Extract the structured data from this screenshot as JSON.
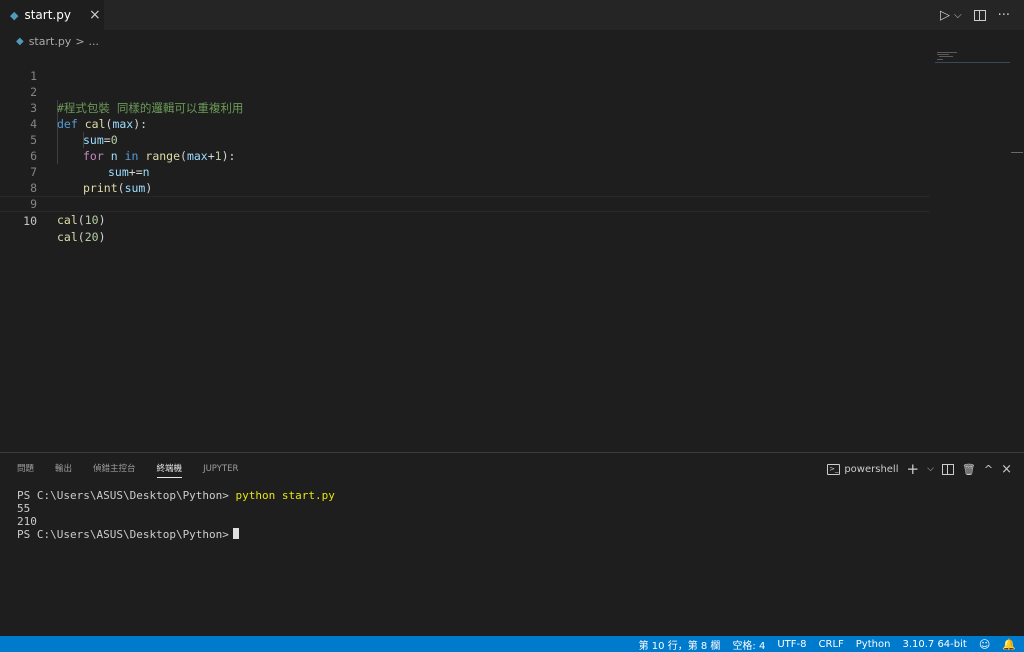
{
  "tab": {
    "filename": "start.py",
    "close_glyph": "×"
  },
  "tab_actions": {
    "run_glyph": "▷",
    "run_menu_glyph": "⌵",
    "more_glyph": "···"
  },
  "breadcrumb": {
    "file": "start.py",
    "separator": ">",
    "symbol": "..."
  },
  "editor": {
    "lines": [
      {
        "n": "1"
      },
      {
        "n": "2",
        "comment": "#程式包裝 同樣的邏輯可以重複利用"
      },
      {
        "n": "3",
        "def": "def",
        "fn": "cal",
        "p1": "(",
        "arg": "max",
        "p2": "):"
      },
      {
        "n": "4",
        "var": "sum",
        "op": "=",
        "num": "0"
      },
      {
        "n": "5",
        "for": "for",
        "v": "n",
        "in": "in",
        "range": "range",
        "a": "(",
        "m": "max",
        "plus": "+",
        "one": "1",
        "b": "):"
      },
      {
        "n": "6",
        "sum": "sum",
        "op": "+=",
        "v": "n"
      },
      {
        "n": "7",
        "fn": "print",
        "a": "(",
        "arg": "sum",
        "b": ")"
      },
      {
        "n": "8"
      },
      {
        "n": "9",
        "fn": "cal",
        "a": "(",
        "num": "10",
        "b": ")"
      },
      {
        "n": "10",
        "fn": "cal",
        "a": "(",
        "num": "20",
        "b": ")"
      }
    ]
  },
  "panel": {
    "tabs": [
      "問題",
      "輸出",
      "偵錯主控台",
      "終端機",
      "JUPYTER"
    ],
    "active_tab": "終端機",
    "terminal_profile": "powershell",
    "ps_glyph": ">_",
    "add_glyph": "+",
    "menu_glyph": "⌵",
    "trash_glyph": "🗑",
    "max_glyph": "^",
    "close_glyph": "×"
  },
  "terminal": {
    "prompt1": "PS C:\\Users\\ASUS\\Desktop\\Python> ",
    "cmd1": "python start.py",
    "out1": "55",
    "out2": "210",
    "prompt2": "PS C:\\Users\\ASUS\\Desktop\\Python>"
  },
  "statusbar": {
    "position": "第 10 行，第 8 欄",
    "spaces": "空格: 4",
    "encoding": "UTF-8",
    "eol": "CRLF",
    "language": "Python",
    "interpreter": "3.10.7 64-bit"
  },
  "colors": {
    "status_bg": "#007acc",
    "editor_bg": "#1e1e1e",
    "tabbar_bg": "#252526",
    "comment": "#6a9955",
    "keyword": "#569cd6",
    "function": "#dcdcaa",
    "variable": "#9cdcfe",
    "number": "#b5cea8"
  }
}
